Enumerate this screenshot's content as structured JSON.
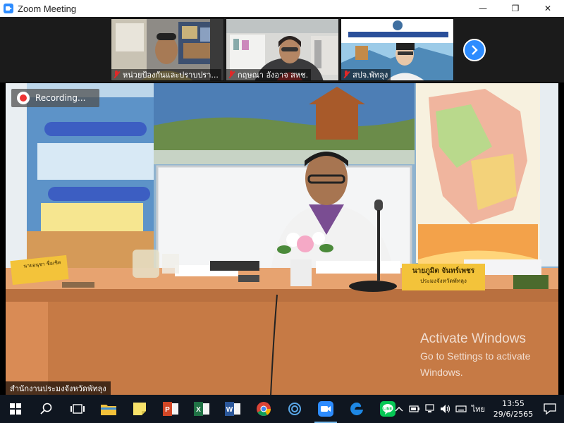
{
  "window": {
    "title": "Zoom Meeting",
    "controls": {
      "minimize": "—",
      "maximize": "❐",
      "close": "✕"
    }
  },
  "gallery": {
    "participants": [
      {
        "name": "หน่วยป้องกันและปราบปรา..."
      },
      {
        "name": "กฤษณา อังอาจ สหช."
      },
      {
        "name": "สปจ.พัทลุง"
      }
    ]
  },
  "main_video": {
    "recording_label": "Recording...",
    "speaker_name": "สำนักงานประมงจังหวัดพัทลุง",
    "nameplate_name": "นายภูมิต จันทร์เพชร",
    "nameplate_title": "ประมงจังหวัดพัทลุง",
    "left_nameplate_name": "นายอนุชา ชื่อเชิด"
  },
  "activation": {
    "heading": "Activate Windows",
    "line1": "Go to Settings to activate",
    "line2": "Windows."
  },
  "taskbar": {
    "apps": [
      "start-icon",
      "search-icon",
      "task-view-icon",
      "file-explorer-icon",
      "sticky-notes-icon",
      "powerpoint-icon",
      "excel-icon",
      "word-icon",
      "chrome-icon",
      "cortana-icon",
      "zoom-icon",
      "edge-icon",
      "line-icon"
    ],
    "tray": {
      "language": "ไทย",
      "time": "13:55",
      "date": "29/6/2565"
    }
  }
}
